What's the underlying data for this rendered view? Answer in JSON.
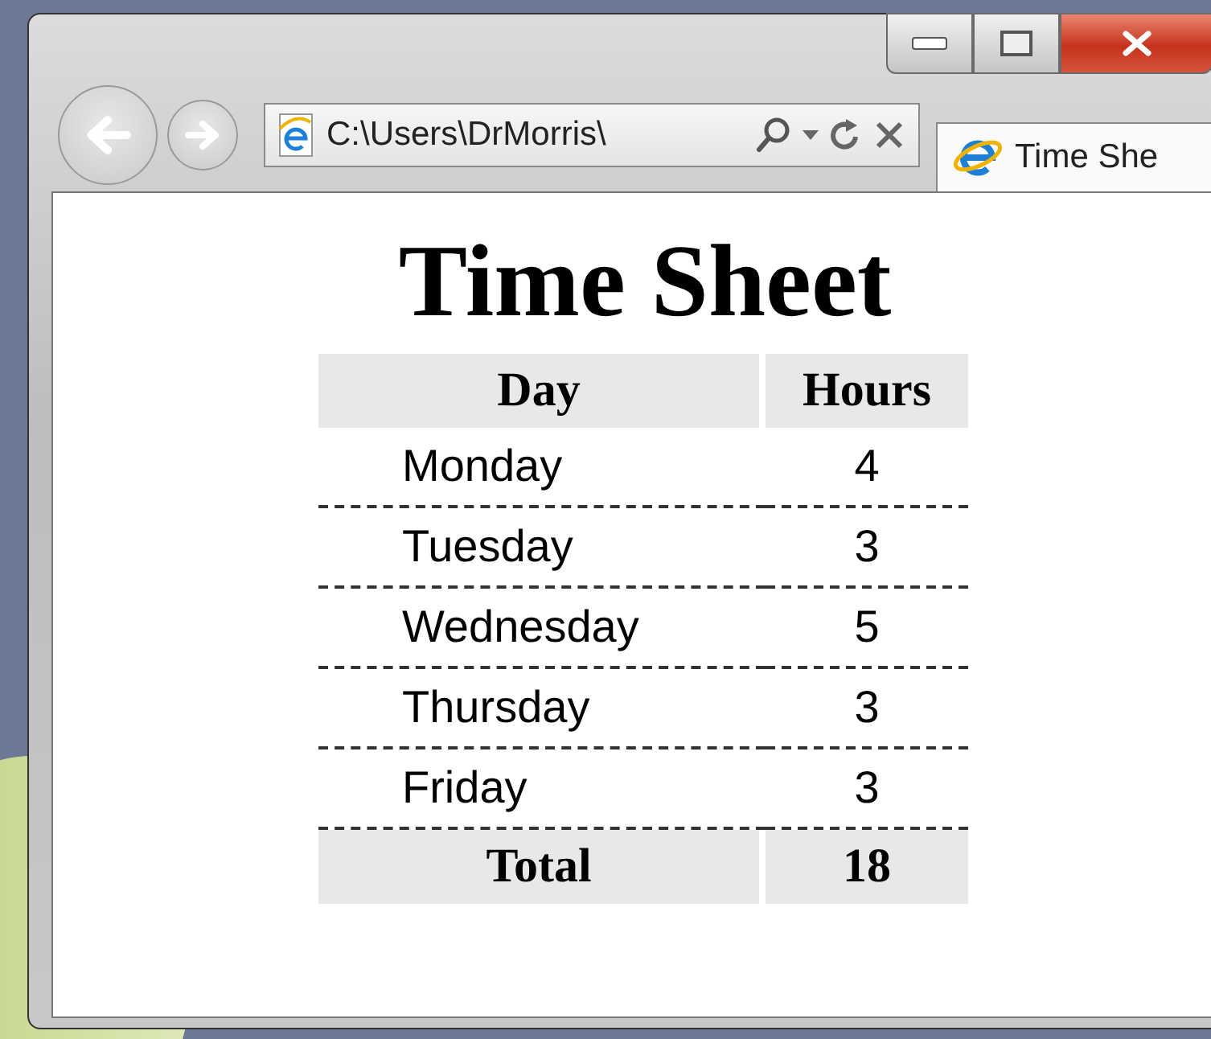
{
  "browser": {
    "address": "C:\\Users\\DrMorris\\",
    "tab_title": "Time She"
  },
  "page": {
    "title": "Time Sheet",
    "columns": [
      "Day",
      "Hours"
    ],
    "rows": [
      {
        "day": "Monday",
        "hours": "4"
      },
      {
        "day": "Tuesday",
        "hours": "3"
      },
      {
        "day": "Wednesday",
        "hours": "5"
      },
      {
        "day": "Thursday",
        "hours": "3"
      },
      {
        "day": "Friday",
        "hours": "3"
      }
    ],
    "total": {
      "label": "Total",
      "value": "18"
    }
  }
}
